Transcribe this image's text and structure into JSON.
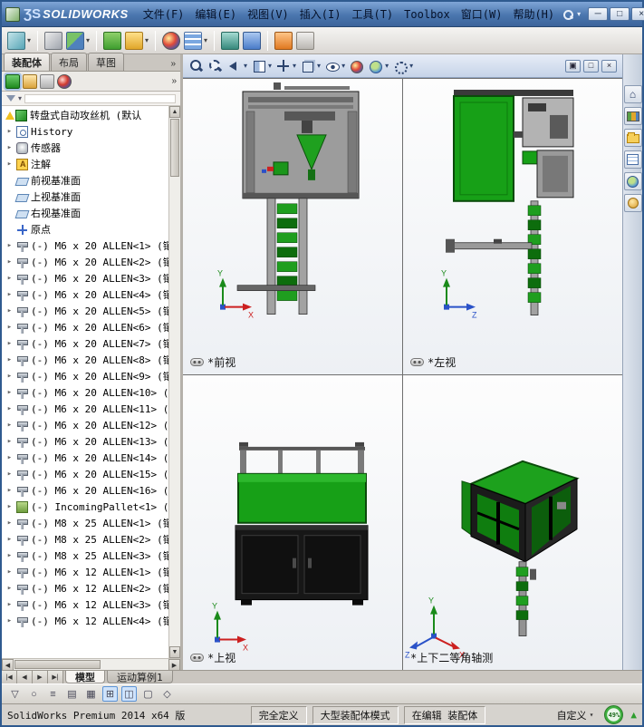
{
  "titlebar": {
    "logo_mark": "ƷS",
    "logo_text": "SOLIDWORKS",
    "menus": [
      {
        "name": "menu-file",
        "label": "文件(F)"
      },
      {
        "name": "menu-edit",
        "label": "编辑(E)"
      },
      {
        "name": "menu-view",
        "label": "视图(V)"
      },
      {
        "name": "menu-insert",
        "label": "插入(I)"
      },
      {
        "name": "menu-tools",
        "label": "工具(T)"
      },
      {
        "name": "menu-toolbox",
        "label": "Toolbox"
      },
      {
        "name": "menu-window",
        "label": "窗口(W)"
      },
      {
        "name": "menu-help",
        "label": "帮助(H)"
      }
    ],
    "quick_caret": "▾",
    "window_buttons": {
      "minimize": "─",
      "maximize": "□",
      "close": "×"
    }
  },
  "toolbar": {
    "items": [
      {
        "name": "view-capture-icon",
        "cls": "tbi v-teal",
        "g": "",
        "ia": "true"
      },
      {
        "name": "toolbar-caret",
        "cls": "tcaret",
        "g": "▾",
        "ia": "true"
      },
      {
        "name": "toolbar-separator",
        "cls": "tsep",
        "g": "",
        "ia": "false"
      },
      {
        "name": "attachments-icon",
        "cls": "tbi v-clip",
        "g": "",
        "ia": "true"
      },
      {
        "name": "component-structure-icon",
        "cls": "tbi v-multi",
        "g": "",
        "ia": "true"
      },
      {
        "name": "toolbar-caret",
        "cls": "tcaret",
        "g": "▾",
        "ia": "true"
      },
      {
        "name": "toolbar-separator",
        "cls": "tsep",
        "g": "",
        "ia": "false"
      },
      {
        "name": "smart-fasteners-icon",
        "cls": "tbi v-green",
        "g": "",
        "ia": "true"
      },
      {
        "name": "show-hidden-components-icon",
        "cls": "tbi v-yellow",
        "g": "",
        "ia": "true"
      },
      {
        "name": "toolbar-caret",
        "cls": "tcaret",
        "g": "▾",
        "ia": "true"
      },
      {
        "name": "toolbar-separator",
        "cls": "tsep",
        "g": "",
        "ia": "false"
      },
      {
        "name": "edit-appearance-icon",
        "cls": "tbi v-sphere",
        "g": "",
        "ia": "true"
      },
      {
        "name": "component-pattern-icon",
        "cls": "tbi v-gridblue",
        "g": "",
        "ia": "true"
      },
      {
        "name": "toolbar-caret",
        "cls": "tcaret",
        "g": "▾",
        "ia": "true"
      },
      {
        "name": "toolbar-separator",
        "cls": "tsep",
        "g": "",
        "ia": "false"
      },
      {
        "name": "motion-study-icon",
        "cls": "tbi v-teal2",
        "g": "",
        "ia": "true"
      },
      {
        "name": "measure-icon",
        "cls": "tbi v-blue",
        "g": "",
        "ia": "true"
      },
      {
        "name": "toolbar-separator",
        "cls": "tsep",
        "g": "",
        "ia": "false"
      },
      {
        "name": "exploded-view-icon",
        "cls": "tbi v-orange",
        "g": "",
        "ia": "true"
      },
      {
        "name": "options-icon",
        "cls": "tbi v-gray",
        "g": "",
        "ia": "true"
      }
    ]
  },
  "left_panel": {
    "tabs": [
      {
        "name": "panel-tab-assembly",
        "label": "装配体",
        "cls": "ptab active"
      },
      {
        "name": "panel-tab-layout",
        "label": "布局",
        "cls": "ptab"
      },
      {
        "name": "panel-tab-sketch",
        "label": "草图",
        "cls": "ptab"
      }
    ],
    "tabs_more": "»",
    "fm_icons": [
      {
        "name": "featuremanager-tree-tab-icon",
        "cls": "fmi fm-tree fm-active"
      },
      {
        "name": "property-manager-tab-icon",
        "cls": "fmi fm-prop"
      },
      {
        "name": "configuration-manager-tab-icon",
        "cls": "fmi fm-config"
      },
      {
        "name": "display-manager-tab-icon",
        "cls": "fmi fm-display"
      }
    ],
    "fm_more": "»",
    "filter_caret": "▾",
    "tree": {
      "root": {
        "name": "tree-root-assembly",
        "label": "转盘式自动攻丝机 (默认"
      },
      "items": [
        {
          "name": "tree-item-history",
          "icls": "ti hist",
          "exp": "▸",
          "label": "History"
        },
        {
          "name": "tree-item-sensors",
          "icls": "ti sensor",
          "exp": "▸",
          "label": "传感器"
        },
        {
          "name": "tree-item-annotations",
          "icls": "ti ann",
          "exp": "▸",
          "label": "注解"
        },
        {
          "name": "tree-item-front-plane",
          "icls": "ti plane",
          "exp": "",
          "label": "前视基准面"
        },
        {
          "name": "tree-item-top-plane",
          "icls": "ti plane",
          "exp": "",
          "label": "上视基准面"
        },
        {
          "name": "tree-item-right-plane",
          "icls": "ti plane",
          "exp": "",
          "label": "右视基准面"
        },
        {
          "name": "tree-item-origin",
          "icls": "ti origin",
          "exp": "",
          "label": "原点"
        },
        {
          "name": "tree-item-m6x20-allen-1",
          "icls": "ti bolt",
          "exp": "▸",
          "label": "(-) M6 x 20 ALLEN<1> (镶"
        },
        {
          "name": "tree-item-m6x20-allen-2",
          "icls": "ti bolt",
          "exp": "▸",
          "label": "(-) M6 x 20 ALLEN<2> (镶"
        },
        {
          "name": "tree-item-m6x20-allen-3",
          "icls": "ti bolt",
          "exp": "▸",
          "label": "(-) M6 x 20 ALLEN<3> (镶"
        },
        {
          "name": "tree-item-m6x20-allen-4",
          "icls": "ti bolt",
          "exp": "▸",
          "label": "(-) M6 x 20 ALLEN<4> (镶"
        },
        {
          "name": "tree-item-m6x20-allen-5",
          "icls": "ti bolt",
          "exp": "▸",
          "label": "(-) M6 x 20 ALLEN<5> (镶"
        },
        {
          "name": "tree-item-m6x20-allen-6",
          "icls": "ti bolt",
          "exp": "▸",
          "label": "(-) M6 x 20 ALLEN<6> (镶"
        },
        {
          "name": "tree-item-m6x20-allen-7",
          "icls": "ti bolt",
          "exp": "▸",
          "label": "(-) M6 x 20 ALLEN<7> (镶"
        },
        {
          "name": "tree-item-m6x20-allen-8",
          "icls": "ti bolt",
          "exp": "▸",
          "label": "(-) M6 x 20 ALLEN<8> (镶"
        },
        {
          "name": "tree-item-m6x20-allen-9",
          "icls": "ti bolt",
          "exp": "▸",
          "label": "(-) M6 x 20 ALLEN<9> (镶"
        },
        {
          "name": "tree-item-m6x20-allen-10",
          "icls": "ti bolt",
          "exp": "▸",
          "label": "(-) M6 x 20 ALLEN<10> ("
        },
        {
          "name": "tree-item-m6x20-allen-11",
          "icls": "ti bolt",
          "exp": "▸",
          "label": "(-) M6 x 20 ALLEN<11> ("
        },
        {
          "name": "tree-item-m6x20-allen-12",
          "icls": "ti bolt",
          "exp": "▸",
          "label": "(-) M6 x 20 ALLEN<12> ("
        },
        {
          "name": "tree-item-m6x20-allen-13",
          "icls": "ti bolt",
          "exp": "▸",
          "label": "(-) M6 x 20 ALLEN<13> ("
        },
        {
          "name": "tree-item-m6x20-allen-14",
          "icls": "ti bolt",
          "exp": "▸",
          "label": "(-) M6 x 20 ALLEN<14> ("
        },
        {
          "name": "tree-item-m6x20-allen-15",
          "icls": "ti bolt",
          "exp": "▸",
          "label": "(-) M6 x 20 ALLEN<15> ("
        },
        {
          "name": "tree-item-m6x20-allen-16",
          "icls": "ti bolt",
          "exp": "▸",
          "label": "(-) M6 x 20 ALLEN<16> ("
        },
        {
          "name": "tree-item-incoming-pallet-1",
          "icls": "ti pallet",
          "exp": "▸",
          "label": "(-) IncomingPallet<1> ("
        },
        {
          "name": "tree-item-m8x25-allen-1",
          "icls": "ti bolt",
          "exp": "▸",
          "label": "(-) M8 x 25 ALLEN<1> (镶"
        },
        {
          "name": "tree-item-m8x25-allen-2",
          "icls": "ti bolt",
          "exp": "▸",
          "label": "(-) M8 x 25 ALLEN<2> (镶"
        },
        {
          "name": "tree-item-m8x25-allen-3",
          "icls": "ti bolt",
          "exp": "▸",
          "label": "(-) M8 x 25 ALLEN<3> (镶"
        },
        {
          "name": "tree-item-m6x12-allen-1",
          "icls": "ti bolt",
          "exp": "▸",
          "label": "(-) M6 x 12 ALLEN<1> (镶"
        },
        {
          "name": "tree-item-m6x12-allen-2",
          "icls": "ti bolt",
          "exp": "▸",
          "label": "(-) M6 x 12 ALLEN<2> (镶"
        },
        {
          "name": "tree-item-m6x12-allen-3",
          "icls": "ti bolt",
          "exp": "▸",
          "label": "(-) M6 x 12 ALLEN<3> (镶"
        },
        {
          "name": "tree-item-m6x12-allen-4",
          "icls": "ti bolt",
          "exp": "▸",
          "label": "(-) M6 x 12 ALLEN<4> (镶"
        }
      ]
    }
  },
  "hud": {
    "items": [
      {
        "name": "zoom-fit-icon",
        "cls": "hic h-mag",
        "g": "",
        "ia": "true"
      },
      {
        "name": "zoom-area-icon",
        "cls": "hic h-magarea",
        "g": "",
        "ia": "true"
      },
      {
        "name": "previous-view-icon",
        "cls": "hic h-prev",
        "g": "",
        "ia": "true"
      },
      {
        "name": "hud-caret",
        "cls": "hcaret",
        "g": "▾",
        "ia": "true"
      },
      {
        "name": "section-view-icon",
        "cls": "hic h-section",
        "g": "",
        "ia": "true"
      },
      {
        "name": "hud-caret",
        "cls": "hcaret",
        "g": "▾",
        "ia": "true"
      },
      {
        "name": "view-orientation-icon",
        "cls": "hic h-orient",
        "g": "",
        "ia": "true"
      },
      {
        "name": "hud-caret",
        "cls": "hcaret",
        "g": "▾",
        "ia": "true"
      },
      {
        "name": "display-style-icon",
        "cls": "hic h-style",
        "g": "",
        "ia": "true"
      },
      {
        "name": "hud-caret",
        "cls": "hcaret",
        "g": "▾",
        "ia": "true"
      },
      {
        "name": "hide-show-items-icon",
        "cls": "hic h-eye",
        "g": "",
        "ia": "true"
      },
      {
        "name": "hud-caret",
        "cls": "hcaret",
        "g": "▾",
        "ia": "true"
      },
      {
        "name": "edit-appearance-icon",
        "cls": "hic h-appear",
        "g": "",
        "ia": "true"
      },
      {
        "name": "apply-scene-icon",
        "cls": "hic h-scene",
        "g": "",
        "ia": "true"
      },
      {
        "name": "hud-caret",
        "cls": "hcaret",
        "g": "▾",
        "ia": "true"
      },
      {
        "name": "view-settings-icon",
        "cls": "hic h-settings",
        "g": "",
        "ia": "true"
      },
      {
        "name": "hud-caret",
        "cls": "hcaret",
        "g": "▾",
        "ia": "true"
      }
    ],
    "pane_buttons": {
      "restore": "▣",
      "maximize": "□",
      "close": "×"
    }
  },
  "viewports": [
    {
      "label": "*前视"
    },
    {
      "label": "*左视"
    },
    {
      "label": "*上视"
    },
    {
      "label": "*上下二等角轴测"
    }
  ],
  "task_pane": {
    "items": [
      {
        "name": "task-pane-home-icon",
        "cls": "tpi tp-home",
        "g": "⌂"
      },
      {
        "name": "design-library-icon",
        "cls": "tpi tp-lib",
        "g": ""
      },
      {
        "name": "file-explorer-icon",
        "cls": "tpi tp-folder",
        "g": ""
      },
      {
        "name": "view-palette-icon",
        "cls": "tpi tp-grid",
        "g": ""
      },
      {
        "name": "appearances-scenes-icon",
        "cls": "tpi tp-globe",
        "g": ""
      },
      {
        "name": "custom-properties-icon",
        "cls": "tpi tp-seal",
        "g": ""
      }
    ]
  },
  "bottom": {
    "nav": [
      {
        "name": "scroll-first-button",
        "g": "|◀"
      },
      {
        "name": "scroll-prev-button",
        "g": "◀"
      },
      {
        "name": "scroll-next-button",
        "g": "▶"
      },
      {
        "name": "scroll-last-button",
        "g": "▶|"
      }
    ],
    "tabs": [
      {
        "name": "tab-model",
        "label": "模型",
        "cls": "mtab active"
      },
      {
        "name": "tab-motion-study-1",
        "label": "运动算例1",
        "cls": "mtab"
      }
    ]
  },
  "snap_toolbar": {
    "items": [
      {
        "name": "select-filter-icon",
        "cls": "sn",
        "g": "▽"
      },
      {
        "name": "sketch-entity-icon",
        "cls": "sn",
        "g": "○"
      },
      {
        "name": "line-format-icon",
        "cls": "sn",
        "g": "≡"
      },
      {
        "name": "layer-icon",
        "cls": "sn",
        "g": "▤"
      },
      {
        "name": "grid-icon",
        "cls": "sn",
        "g": "▦"
      },
      {
        "name": "snap-points-icon",
        "cls": "sn sel",
        "g": "⊞"
      },
      {
        "name": "snap-grid-icon",
        "cls": "sn sel",
        "g": "◫"
      },
      {
        "name": "table-icon",
        "cls": "sn",
        "g": "▢"
      },
      {
        "name": "note-icon",
        "cls": "sn",
        "g": "◇"
      }
    ]
  },
  "status": {
    "app": "SolidWorks Premium 2014 x64 版",
    "definition": "完全定义",
    "mode": "大型装配体模式",
    "editing": "在编辑 装配体",
    "custom": "自定义",
    "custom_caret": "▾",
    "resource": "49%",
    "resource_arrow": "▲"
  }
}
